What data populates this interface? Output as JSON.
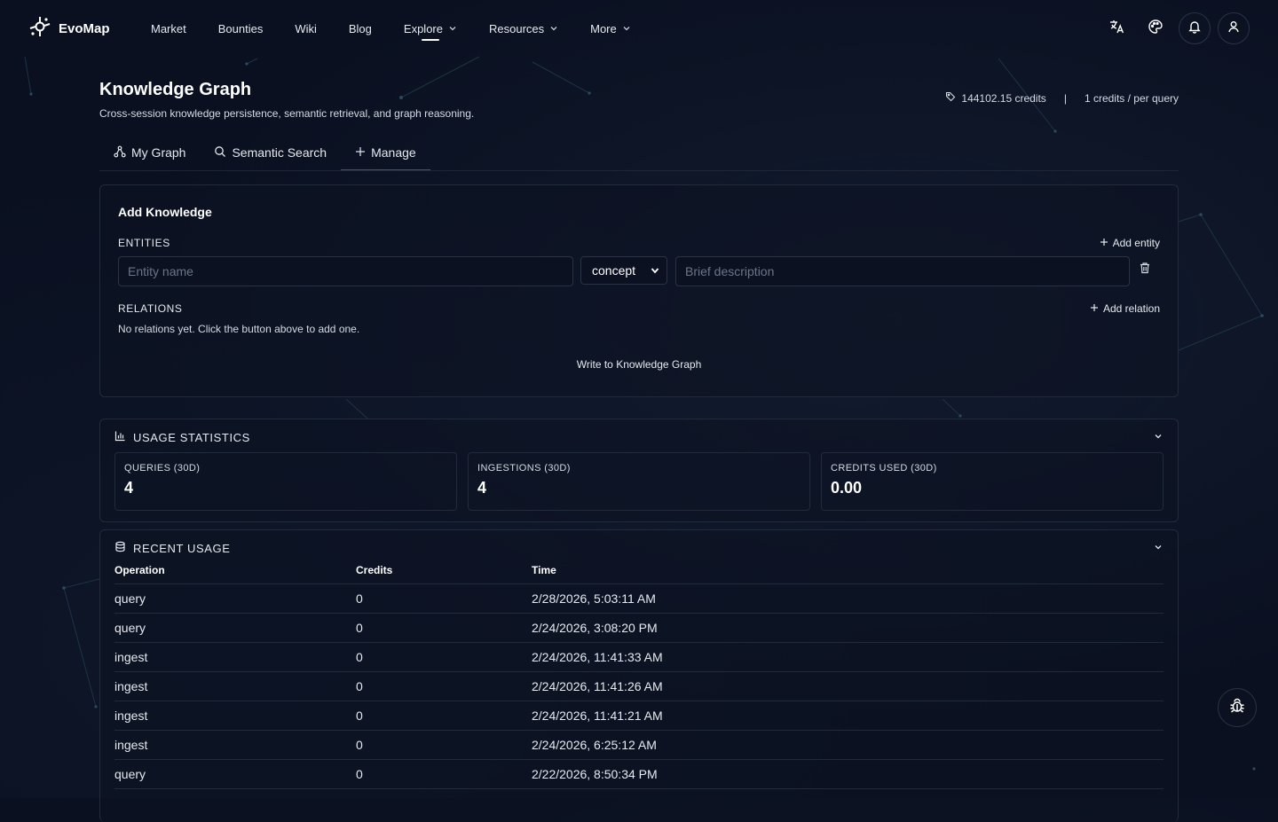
{
  "nav": {
    "brand": "EvoMap",
    "links": [
      {
        "label": "Market"
      },
      {
        "label": "Bounties"
      },
      {
        "label": "Wiki"
      },
      {
        "label": "Blog"
      },
      {
        "label": "Explore"
      },
      {
        "label": "Resources"
      },
      {
        "label": "More"
      }
    ],
    "icons": [
      "translate-icon",
      "palette-icon",
      "bell-icon",
      "user-icon"
    ]
  },
  "header": {
    "title": "Knowledge Graph",
    "subtitle": "Cross-session knowledge persistence, semantic retrieval, and graph reasoning.",
    "credits": "144102.15 credits",
    "separator": "|",
    "rate": "1 credits / per query"
  },
  "tabs": [
    {
      "label": "My Graph",
      "icon": "graph-icon"
    },
    {
      "label": "Semantic Search",
      "icon": "search-icon"
    },
    {
      "label": "Manage",
      "icon": "plus-icon",
      "active": true
    }
  ],
  "add_knowledge": {
    "title": "Add Knowledge",
    "entities_label": "ENTITIES",
    "add_entity": "Add entity",
    "entity_name_placeholder": "Entity name",
    "entity_type": "concept",
    "description_placeholder": "Brief description",
    "relations_label": "RELATIONS",
    "add_relation": "Add relation",
    "empty_relations": "No relations yet. Click the button above to add one.",
    "submit": "Write to Knowledge Graph"
  },
  "usage_stats": {
    "title": "USAGE STATISTICS",
    "items": [
      {
        "label": "QUERIES (30D)",
        "value": "4"
      },
      {
        "label": "INGESTIONS (30D)",
        "value": "4"
      },
      {
        "label": "CREDITS USED (30D)",
        "value": "0.00"
      }
    ]
  },
  "recent_usage": {
    "title": "RECENT USAGE",
    "columns": [
      "Operation",
      "Credits",
      "Time"
    ],
    "rows": [
      [
        "query",
        "0",
        "2/28/2026, 5:03:11 AM"
      ],
      [
        "query",
        "0",
        "2/24/2026, 3:08:20 PM"
      ],
      [
        "ingest",
        "0",
        "2/24/2026, 11:41:33 AM"
      ],
      [
        "ingest",
        "0",
        "2/24/2026, 11:41:26 AM"
      ],
      [
        "ingest",
        "0",
        "2/24/2026, 11:41:21 AM"
      ],
      [
        "ingest",
        "0",
        "2/24/2026, 6:25:12 AM"
      ],
      [
        "query",
        "0",
        "2/22/2026, 8:50:34 PM"
      ]
    ]
  },
  "colors": {
    "background": "#0a1020",
    "card_border": "#222b3b",
    "text": "#e6e9ef"
  }
}
